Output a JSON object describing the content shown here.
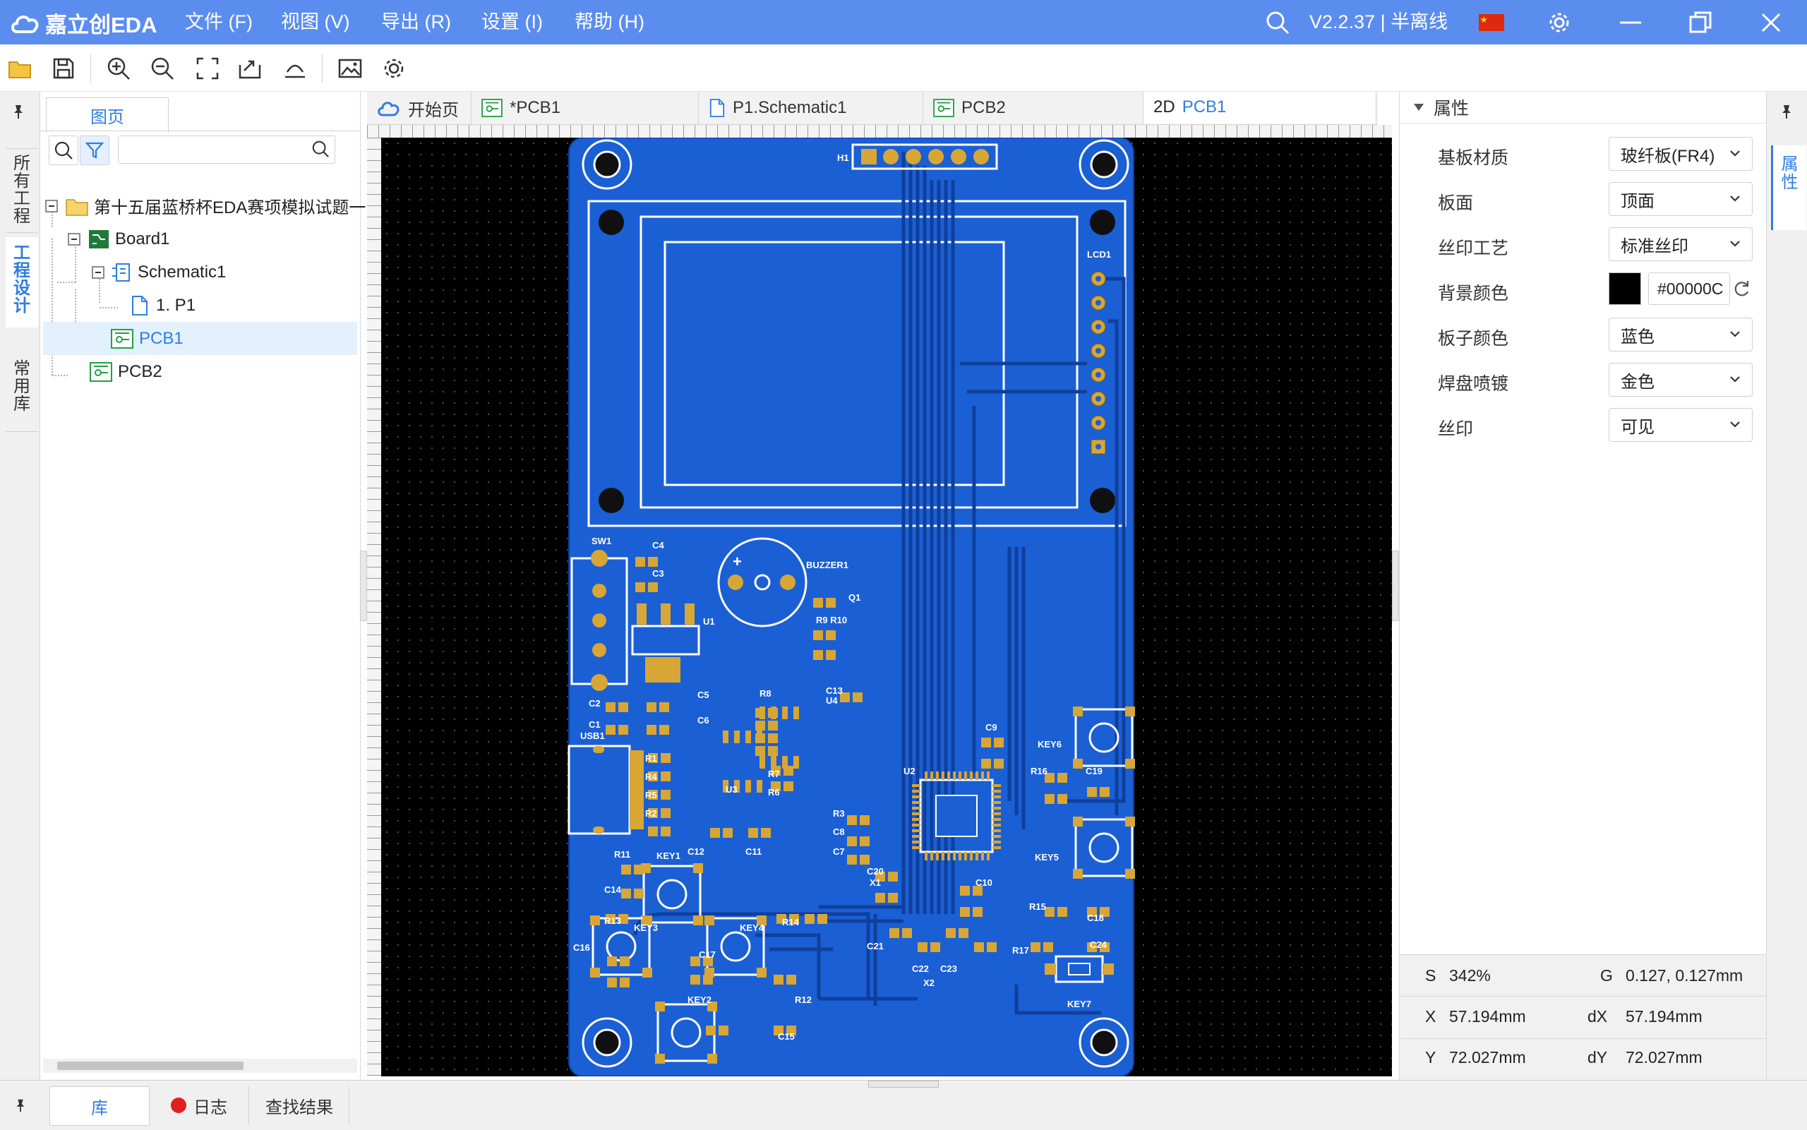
{
  "app": {
    "logo_text": "嘉立创EDA",
    "version": "V2.2.37 | 半离线",
    "brand_color": "#5b8def"
  },
  "menu": [
    {
      "label": "文件 (F)"
    },
    {
      "label": "视图 (V)"
    },
    {
      "label": "导出 (R)"
    },
    {
      "label": "设置 (I)"
    },
    {
      "label": "帮助 (H)"
    }
  ],
  "left_vtabs": [
    {
      "label": "所有工程"
    },
    {
      "label": "工程设计"
    },
    {
      "label": "常用库"
    }
  ],
  "left_panel": {
    "tab": "图页",
    "search_placeholder": "",
    "tree": [
      {
        "label": "第十五届蓝桥杯EDA赛项模拟试题一",
        "icon": "folder-icon"
      },
      {
        "label": "Board1",
        "icon": "board-icon"
      },
      {
        "label": "Schematic1",
        "icon": "schematic-icon"
      },
      {
        "label": "1. P1",
        "icon": "page-icon"
      },
      {
        "label": "PCB1",
        "icon": "pcb-icon"
      },
      {
        "label": "PCB2",
        "icon": "pcb-icon"
      }
    ]
  },
  "editor_tabs": [
    {
      "label": "开始页",
      "icon": "cloud-icon"
    },
    {
      "label": "*PCB1",
      "icon": "pcb-icon"
    },
    {
      "label": "P1.Schematic1",
      "icon": "page-icon"
    },
    {
      "label": "PCB2",
      "icon": "pcb-icon"
    },
    {
      "prefix": "2D",
      "label": "PCB1"
    }
  ],
  "pcb": {
    "board_color": "#1a5fd6",
    "labels": {
      "h1": "H1",
      "lcd1": "LCD1",
      "sw1": "SW1",
      "c4": "C4",
      "c3": "C3",
      "u1": "U1",
      "buzzer1": "BUZZER1",
      "q1": "Q1",
      "r9r10": "R9 R10",
      "c5": "C5",
      "c6": "C6",
      "c2": "C2",
      "c1": "C1",
      "usb1": "USB1",
      "r8": "R8",
      "c13": "C13",
      "u4": "U4",
      "r1": "R1",
      "r4": "R4",
      "r5": "R5",
      "r2": "R2",
      "u3": "U3",
      "r7": "R7",
      "r6": "R6",
      "c9": "C9",
      "u2": "U2",
      "key6": "KEY6",
      "r16": "R16",
      "c19": "C19",
      "r3": "R3",
      "c8": "C8",
      "c7": "C7",
      "key5": "KEY5",
      "c20": "C20",
      "x1": "X1",
      "c10": "C10",
      "r11": "R11",
      "key1": "KEY1",
      "c12": "C12",
      "c11": "C11",
      "c14": "C14",
      "r13": "R13",
      "key3": "KEY3",
      "key4": "KEY4",
      "r14": "R14",
      "c21": "C21",
      "c22": "C22",
      "c23": "C23",
      "x2": "X2",
      "r15": "R15",
      "c18": "C18",
      "r17": "R17",
      "c24": "C24",
      "c16": "C16",
      "c17": "C17",
      "key2": "KEY2",
      "r12": "R12",
      "c15": "C15",
      "key7": "KEY7"
    }
  },
  "properties": {
    "header": "属性",
    "rows": [
      {
        "label": "基板材质",
        "value": "玻纤板(FR4)"
      },
      {
        "label": "板面",
        "value": "顶面"
      },
      {
        "label": "丝印工艺",
        "value": "标准丝印"
      },
      {
        "label": "背景颜色",
        "value": "#00000C",
        "swatch": "#000000"
      },
      {
        "label": "板子颜色",
        "value": "蓝色"
      },
      {
        "label": "焊盘喷镀",
        "value": "金色"
      },
      {
        "label": "丝印",
        "value": "可见"
      }
    ]
  },
  "status": {
    "s_label": "S",
    "s_value": "342%",
    "g_label": "G",
    "g_value": "0.127, 0.127mm",
    "x_label": "X",
    "x_value": "57.194mm",
    "dx_label": "dX",
    "dx_value": "57.194mm",
    "y_label": "Y",
    "y_value": "72.027mm",
    "dy_label": "dY",
    "dy_value": "72.027mm"
  },
  "right_vtab": "属性",
  "bottom_tabs": [
    {
      "label": "库"
    },
    {
      "label": "日志",
      "dot_color": "#e02020"
    },
    {
      "label": "查找结果"
    }
  ]
}
